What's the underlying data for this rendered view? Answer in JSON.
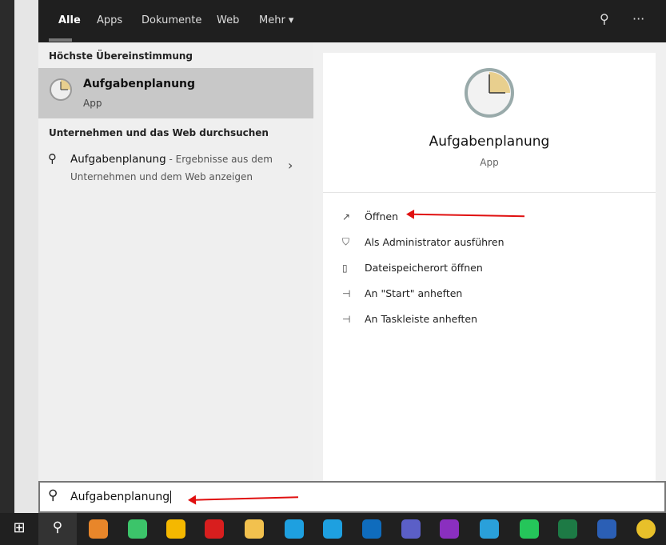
{
  "tabs": [
    "Alle",
    "Apps",
    "Dokumente",
    "Web",
    "Mehr ▾"
  ],
  "left": {
    "best_match_heading": "Höchste Übereinstimmung",
    "best_match_title": "Aufgabenplanung",
    "best_match_type": "App",
    "web_heading": "Unternehmen und das Web durchsuchen",
    "web_item_title": "Aufgabenplanung",
    "web_item_suffix": " - Ergebnisse aus dem",
    "web_item_line2": "Unternehmen und dem Web anzeigen"
  },
  "right": {
    "title": "Aufgabenplanung",
    "type": "App",
    "actions": [
      "Öffnen",
      "Als Administrator ausführen",
      "Dateispeicherort öffnen",
      "An \"Start\" anheften",
      "An Taskleiste anheften"
    ]
  },
  "search": {
    "value": "Aufgabenplanung"
  },
  "taskbar": {
    "icons": [
      "start",
      "search",
      "app-orange",
      "app-green",
      "app-yellow",
      "app-red",
      "file-explorer",
      "skype",
      "skype-2",
      "outlook",
      "teams",
      "onenote",
      "telegram",
      "whatsapp",
      "excel",
      "word",
      "chrome"
    ],
    "colors": [
      "#ffffff",
      "#ffffff",
      "#e8862a",
      "#3cc46a",
      "#f5b800",
      "#d81e1e",
      "#f2c14e",
      "#1ea0e0",
      "#1ea0e0",
      "#0f6cbd",
      "#5b5fc7",
      "#8a2fbf",
      "#2aa0da",
      "#25c55a",
      "#1d7a45",
      "#2b5fb5",
      "#e8c02a"
    ]
  }
}
